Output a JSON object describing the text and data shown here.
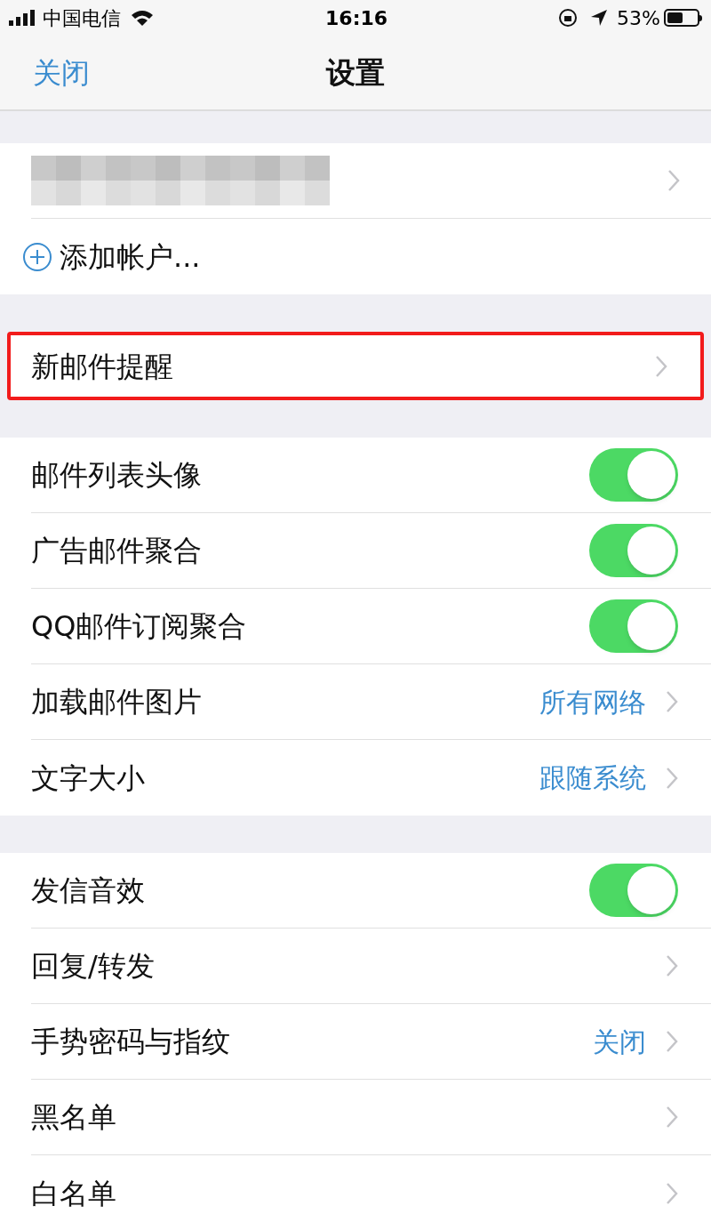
{
  "status_bar": {
    "carrier": "中国电信",
    "time": "16:16",
    "battery": "53%"
  },
  "nav": {
    "close": "关闭",
    "title": "设置"
  },
  "sections": [
    {
      "items": [
        {
          "kind": "account"
        },
        {
          "kind": "add",
          "label": "添加帐户..."
        }
      ]
    },
    {
      "items": [
        {
          "kind": "link",
          "label": "新邮件提醒",
          "highlighted": true
        }
      ]
    },
    {
      "items": [
        {
          "kind": "toggle",
          "label": "邮件列表头像",
          "on": true
        },
        {
          "kind": "toggle",
          "label": "广告邮件聚合",
          "on": true
        },
        {
          "kind": "toggle",
          "label": "QQ邮件订阅聚合",
          "on": true
        },
        {
          "kind": "link",
          "label": "加载邮件图片",
          "value": "所有网络",
          "highlighted": false
        },
        {
          "kind": "link",
          "label": "文字大小",
          "value": "跟随系统",
          "highlighted": false
        }
      ]
    },
    {
      "items": [
        {
          "kind": "toggle",
          "label": "发信音效",
          "on": true
        },
        {
          "kind": "link",
          "label": "回复/转发",
          "highlighted": false
        },
        {
          "kind": "link",
          "label": "手势密码与指纹",
          "value": "关闭",
          "highlighted": false
        },
        {
          "kind": "link",
          "label": "黑名单",
          "highlighted": false
        },
        {
          "kind": "link",
          "label": "白名单",
          "highlighted": false
        }
      ]
    }
  ]
}
